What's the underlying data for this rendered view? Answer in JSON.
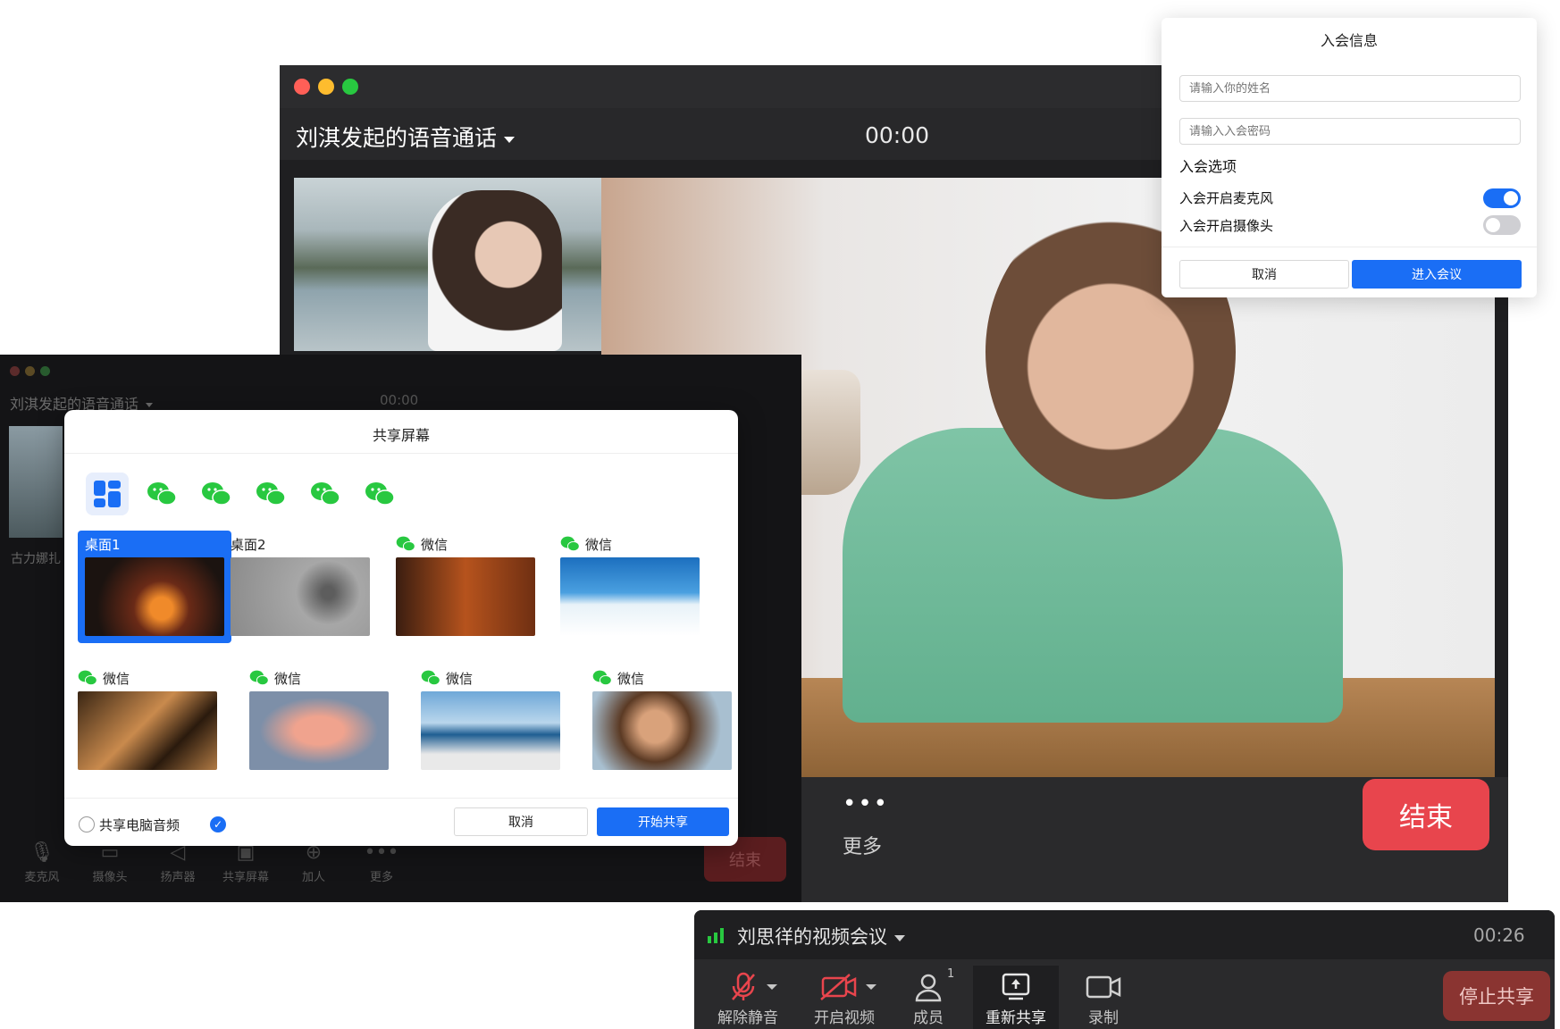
{
  "colors": {
    "accent": "#1a6ef5",
    "end_red": "#e8454d",
    "mac_red": "#ff5f57",
    "mac_yellow": "#febc2e",
    "mac_green": "#28c840",
    "wechat_green": "#28c840"
  },
  "main_window": {
    "title": "刘淇发起的语音通话",
    "timer": "00:00",
    "more_dots": "•••",
    "more_label": "更多",
    "end_label": "结束"
  },
  "join_panel": {
    "title": "入会信息",
    "name_placeholder": "请输入你的姓名",
    "password_placeholder": "请输入入会密码",
    "options_label": "入会选项",
    "mic_label": "入会开启麦克风",
    "mic_on": true,
    "camera_label": "入会开启摄像头",
    "camera_on": false,
    "cancel_label": "取消",
    "enter_label": "进入会议"
  },
  "background_window": {
    "title": "刘淇发起的语音通话",
    "timer": "00:00",
    "participant_name": "古力娜扎",
    "tools": [
      {
        "label": "麦克风",
        "icon": "mic-icon"
      },
      {
        "label": "摄像头",
        "icon": "camera-icon"
      },
      {
        "label": "扬声器",
        "icon": "speaker-icon"
      },
      {
        "label": "共享屏幕",
        "icon": "share-screen-icon"
      },
      {
        "label": "加人",
        "icon": "add-person-icon"
      },
      {
        "label": "更多",
        "icon": "more-icon"
      }
    ],
    "end_label": "结束"
  },
  "share_dialog": {
    "title": "共享屏幕",
    "app_icons": [
      "desktop-grid-icon",
      "wechat-icon",
      "wechat-icon",
      "wechat-icon",
      "wechat-icon",
      "wechat-icon"
    ],
    "windows": [
      {
        "label": "桌面1",
        "selected": true
      },
      {
        "label": "桌面2",
        "selected": false
      },
      {
        "label": "微信",
        "selected": false
      },
      {
        "label": "微信",
        "selected": false
      },
      {
        "label": "微信",
        "selected": false
      },
      {
        "label": "微信",
        "selected": false
      },
      {
        "label": "微信",
        "selected": false
      },
      {
        "label": "微信",
        "selected": false
      }
    ],
    "share_audio_label": "共享电脑音频",
    "share_audio_checked": true,
    "cancel_label": "取消",
    "start_label": "开始共享"
  },
  "share_bar": {
    "title": "刘思徉的视频会议",
    "timer": "00:26",
    "tools": [
      {
        "label": "解除静音",
        "icon": "mic-muted-icon"
      },
      {
        "label": "开启视频",
        "icon": "video-off-icon"
      },
      {
        "label": "成员",
        "icon": "members-icon",
        "badge": "1"
      },
      {
        "label": "重新共享",
        "icon": "share-screen-icon"
      },
      {
        "label": "录制",
        "icon": "record-icon"
      }
    ],
    "stop_label": "停止共享"
  }
}
